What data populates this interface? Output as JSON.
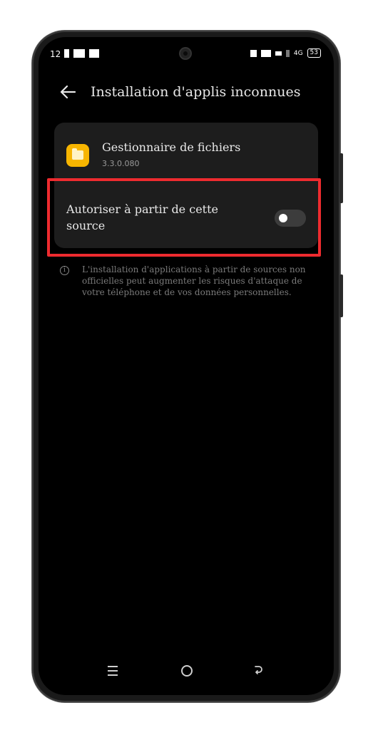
{
  "status_bar": {
    "time": "12",
    "network": "4G",
    "battery": "53"
  },
  "header": {
    "title": "Installation d'applis inconnues",
    "back_icon": "arrow-left-icon"
  },
  "app": {
    "name": "Gestionnaire de fichiers",
    "version": "3.3.0.080",
    "icon": "folder-icon",
    "icon_color": "#f7b500"
  },
  "setting": {
    "label": "Autoriser à partir de cette source",
    "enabled": false
  },
  "info": {
    "icon": "info-icon",
    "text": "L'installation d'applications à partir de sources non officielles peut augmenter les risques d'attaque de votre téléphone et de vos données personnelles."
  },
  "colors": {
    "highlight": "#ee2b2f",
    "background": "#000000",
    "card": "#1d1d1d"
  },
  "nav": {
    "menu_icon": "menu-icon",
    "home_icon": "home-icon",
    "back_icon": "back-icon"
  }
}
